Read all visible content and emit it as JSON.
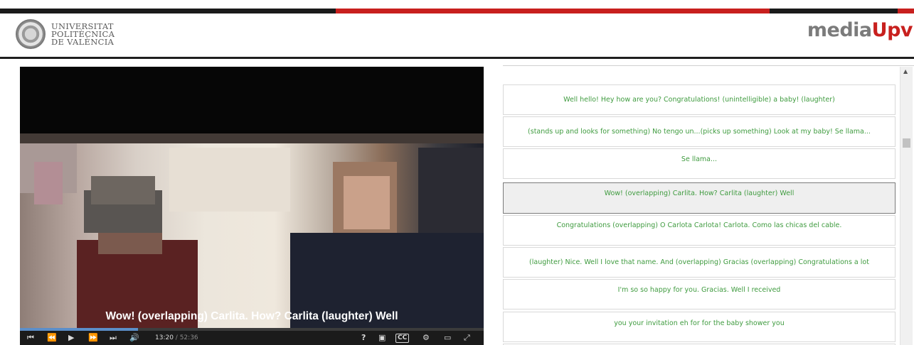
{
  "header": {
    "university_lines": [
      "UNIVERSITAT",
      "POLITÈCNICA",
      "DE VALÈNCIA"
    ],
    "media_logo_prefix": "media",
    "media_logo_suffix": "Upv"
  },
  "player": {
    "subtitle": "Wow! (overlapping) Carlita. How? Carlita (laughter) Well",
    "current_time": "13:20",
    "separator": " / ",
    "duration": "52:36",
    "progress_fraction": 0.254,
    "controls": {
      "skip_back_icon": "⏮",
      "rewind_icon": "⏪",
      "play_icon": "▶",
      "forward_icon": "⏩",
      "skip_forward_icon": "⏭",
      "volume_icon": "🔊",
      "help_icon": "?",
      "transcript_icon": "▣",
      "captions_label": "CC",
      "settings_icon": "⚙",
      "layout_icon": "▭",
      "fullscreen_icon": "⤢"
    }
  },
  "transcript": {
    "segments": [
      {
        "text": "Well hello! Hey how are you? Congratulations! (unintelligible) a baby! (laughter)",
        "active": false
      },
      {
        "text": "(stands up and looks for something) No tengo un...(picks up something) Look at my baby! Se llama...",
        "active": false
      },
      {
        "text": "Se llama...",
        "active": false
      },
      {
        "text": "Wow! (overlapping) Carlita. How? Carlita (laughter) Well",
        "active": true
      },
      {
        "text": "Congratulations (overlapping) O Carlota Carlota! Carlota. Como las chicas del cable.",
        "active": false
      },
      {
        "text": "(laughter) Nice. Well I love that name. And (overlapping) Gracias (overlapping) Congratulations a lot",
        "active": false
      },
      {
        "text": "I'm so so happy for you. Gracias. Well I received",
        "active": false
      },
      {
        "text": "you your invitation eh for for the baby shower you",
        "active": false
      }
    ]
  },
  "colors": {
    "brand_red": "#c8201e",
    "transcript_text": "#3f9b3f",
    "progress": "#5b8ec9"
  }
}
